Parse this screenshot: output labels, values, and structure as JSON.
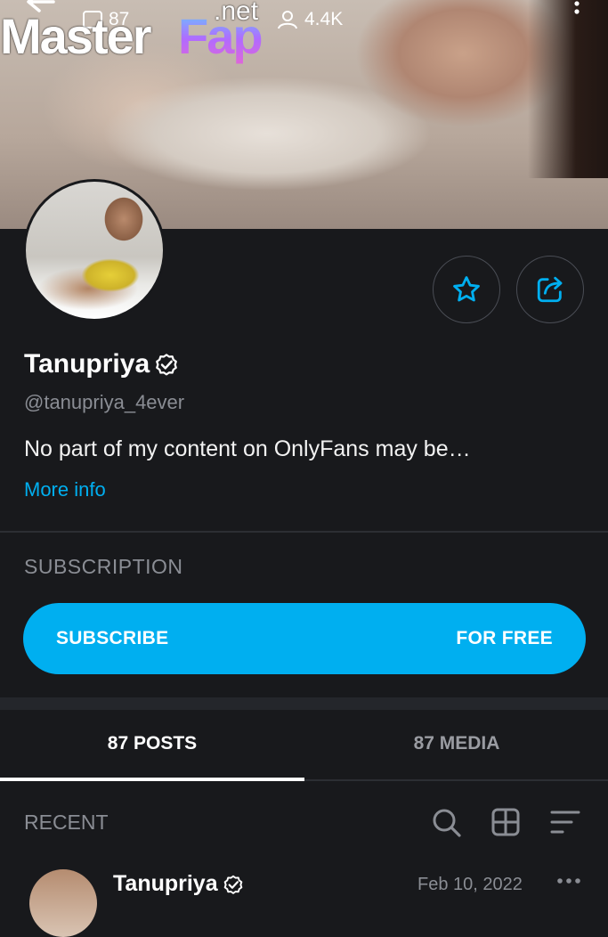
{
  "cover": {
    "photos_count": "87",
    "likes_count": "4.4K"
  },
  "watermark": {
    "part1": "Master",
    "part2": "Fap",
    "part3": ".net"
  },
  "profile": {
    "name": "Tanupriya",
    "handle": "@tanupriya_4ever",
    "bio": "No part of my content on OnlyFans may be…",
    "more_info": "More info"
  },
  "subscription": {
    "section_label": "SUBSCRIPTION",
    "button_left": "SUBSCRIBE",
    "button_right": "FOR FREE"
  },
  "tabs": [
    {
      "label": "87 POSTS",
      "active": true
    },
    {
      "label": "87 MEDIA",
      "active": false
    }
  ],
  "feed": {
    "section_label": "RECENT"
  },
  "post": {
    "author": "Tanupriya",
    "date": "Feb 10, 2022"
  },
  "colors": {
    "accent": "#00aff0",
    "background": "#18191c",
    "muted_text": "#8a8d94"
  },
  "icons": [
    "back-arrow-icon",
    "image-icon",
    "user-icon",
    "more-vertical-icon",
    "star-icon",
    "share-icon",
    "verified-icon",
    "search-icon",
    "grid-icon",
    "sort-icon",
    "more-horizontal-icon"
  ]
}
